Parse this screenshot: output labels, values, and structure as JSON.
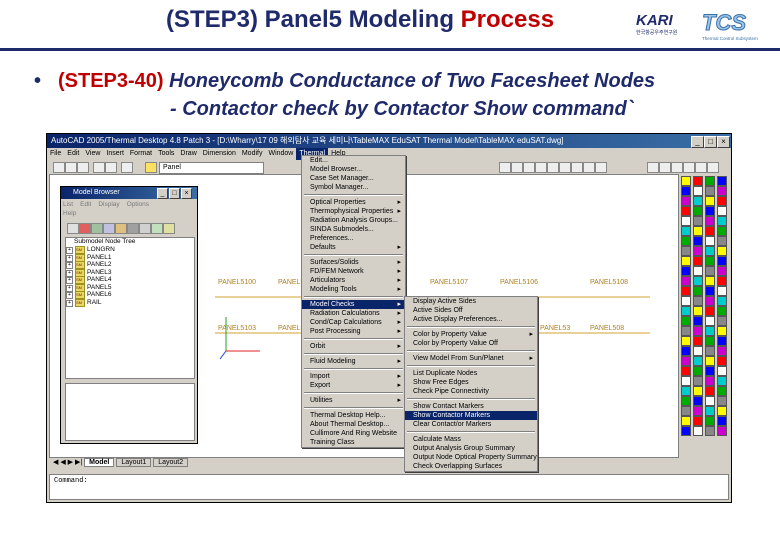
{
  "slide": {
    "title_prefix": "(STEP3) Panel5 Modeling ",
    "title_highlight": "Process",
    "bullet": "•",
    "step_label": "(STEP3-40)",
    "heading_line1": " Honeycomb Conductance of Two Facesheet Nodes",
    "heading_line2": "- Contactor check by Contactor Show command`",
    "logo_kari": "KARI",
    "logo_kari_sub": "한국항공우주연구원",
    "logo_tcs": "TCS",
    "logo_tcs_sub": "Thermal Control Subsystem"
  },
  "window": {
    "title": "AutoCAD 2005/Thermal Desktop 4.8 Patch 3 - [D:\\Wharry\\17 09 해외탐사 교육 세미나\\TableMAX EduSAT Thermal Model\\TableMAX eduSAT.dwg]",
    "menubar": [
      "File",
      "Edit",
      "View",
      "Insert",
      "Format",
      "Tools",
      "Draw",
      "Dimension",
      "Modify",
      "Window",
      "Thermal",
      "Help"
    ],
    "layer_value": "Panel",
    "command_label": "Command:",
    "tabs": [
      "Model",
      "Layout1",
      "Layout2"
    ]
  },
  "thermal_menu": [
    {
      "label": "Edit...",
      "arrow": false
    },
    {
      "label": "Model Browser...",
      "arrow": false
    },
    {
      "label": "Case Set Manager...",
      "arrow": false
    },
    {
      "label": "Symbol Manager...",
      "arrow": false
    },
    {
      "sep": true
    },
    {
      "label": "Optical Properties",
      "arrow": true
    },
    {
      "label": "Thermophysical Properties",
      "arrow": true
    },
    {
      "label": "Radiation Analysis Groups...",
      "arrow": false
    },
    {
      "label": "SINDA Submodels...",
      "arrow": false
    },
    {
      "label": "Preferences...",
      "arrow": false
    },
    {
      "label": "Defaults",
      "arrow": true
    },
    {
      "sep": true
    },
    {
      "label": "Surfaces/Solids",
      "arrow": true
    },
    {
      "label": "FD/FEM Network",
      "arrow": true
    },
    {
      "label": "Articulators",
      "arrow": true
    },
    {
      "label": "Modeling Tools",
      "arrow": true
    },
    {
      "sep": true
    },
    {
      "label": "Model Checks",
      "arrow": true,
      "selected": true
    },
    {
      "label": "Radiation Calculations",
      "arrow": true
    },
    {
      "label": "Cond/Cap Calculations",
      "arrow": true
    },
    {
      "label": "Post Processing",
      "arrow": true
    },
    {
      "sep": true
    },
    {
      "label": "Orbit",
      "arrow": true
    },
    {
      "sep": true
    },
    {
      "label": "Fluid Modeling",
      "arrow": true
    },
    {
      "sep": true
    },
    {
      "label": "Import",
      "arrow": true
    },
    {
      "label": "Export",
      "arrow": true
    },
    {
      "sep": true
    },
    {
      "label": "Utilities",
      "arrow": true
    },
    {
      "sep": true
    },
    {
      "label": "Thermal Desktop Help...",
      "arrow": false
    },
    {
      "label": "About Thermal Desktop...",
      "arrow": false
    },
    {
      "label": "Cullimore And Ring Website",
      "arrow": false
    },
    {
      "label": "Training Class",
      "arrow": false
    }
  ],
  "model_checks_menu": [
    {
      "label": "Display Active Sides",
      "arrow": false
    },
    {
      "label": "Active Sides Off",
      "arrow": false
    },
    {
      "label": "Active Display Preferences...",
      "arrow": false
    },
    {
      "sep": true
    },
    {
      "label": "Color by Property Value",
      "arrow": true
    },
    {
      "label": "Color by Property Value Off",
      "arrow": false
    },
    {
      "sep": true
    },
    {
      "label": "View Model From Sun/Planet",
      "arrow": true
    },
    {
      "sep": true
    },
    {
      "label": "List Duplicate Nodes",
      "arrow": false
    },
    {
      "label": "Show Free Edges",
      "arrow": false
    },
    {
      "label": "Check Pipe Connectivity",
      "arrow": false
    },
    {
      "sep": true
    },
    {
      "label": "Show Contact Markers",
      "arrow": false
    },
    {
      "label": "Show Contactor Markers",
      "arrow": false,
      "selected": true
    },
    {
      "label": "Clear Contact/or Markers",
      "arrow": false
    },
    {
      "sep": true
    },
    {
      "label": "Calculate Mass",
      "arrow": false
    },
    {
      "label": "Output Analysis Group Summary",
      "arrow": false
    },
    {
      "label": "Output Node Optical Property Summary",
      "arrow": false
    },
    {
      "label": "Check Overlapping Surfaces",
      "arrow": false
    }
  ],
  "model_browser": {
    "title": "Model Browser",
    "menu": [
      "List",
      "Edit",
      "Display",
      "Options",
      "Help"
    ],
    "tree_root": "Submodel Node Tree",
    "nodes": [
      "LONGRN",
      "PANEL1",
      "PANEL2",
      "PANEL3",
      "PANEL4",
      "PANEL5",
      "PANEL6",
      "RAIL"
    ]
  },
  "drawing_labels": [
    "PANEL5100",
    "PANEL5",
    "PANEL5107",
    "PANEL5106",
    "PANEL5108",
    "PANEL5103",
    "PANEL5101",
    "PANEL53",
    "PANEL508"
  ],
  "colors": {
    "accent": "#0a246a",
    "title_red": "#c00000",
    "title_blue": "#1f2a6b",
    "node_label": "#b08020"
  }
}
